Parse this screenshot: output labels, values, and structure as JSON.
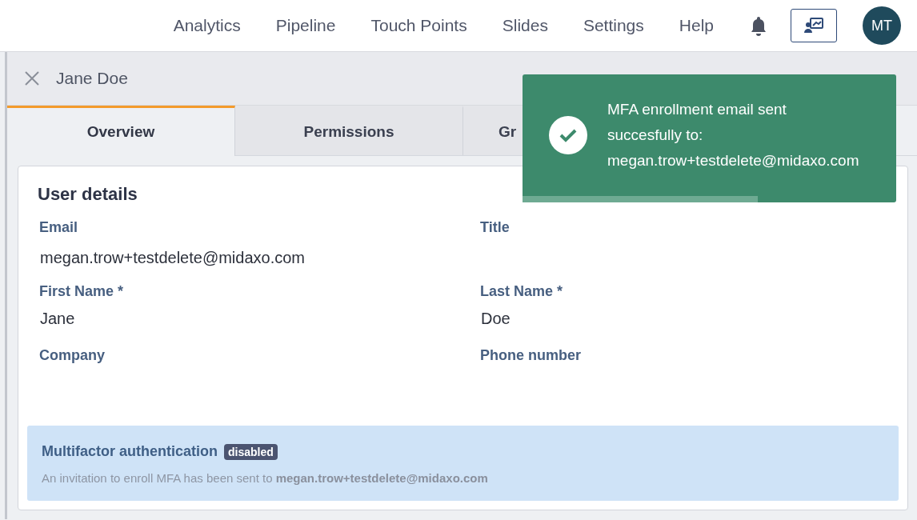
{
  "nav": {
    "links": [
      {
        "label": "Analytics"
      },
      {
        "label": "Pipeline"
      },
      {
        "label": "Touch Points"
      },
      {
        "label": "Slides"
      },
      {
        "label": "Settings"
      },
      {
        "label": "Help"
      }
    ],
    "avatar": "MT"
  },
  "panel": {
    "title": "Jane Doe",
    "tabs": [
      {
        "label": "Overview",
        "selected": true
      },
      {
        "label": "Permissions",
        "selected": false
      },
      {
        "label": "Gr",
        "selected": false
      }
    ],
    "section_title": "User details",
    "fields": [
      {
        "label": "Email",
        "value": "megan.trow+testdelete@midaxo.com"
      },
      {
        "label": "Title"
      },
      {
        "label": "First Name *",
        "value": "Jane"
      },
      {
        "label": "Last Name *",
        "value": "Doe"
      },
      {
        "label": "Company"
      },
      {
        "label": "Phone number"
      }
    ],
    "mfa": {
      "title": "Multifactor authentication",
      "badge": "disabled",
      "message": "An invitation to enroll MFA has been sent to **megan.trow+testdelete@midaxo.com**"
    }
  },
  "toast": {
    "lines": [
      "MFA enrollment email sent",
      "succesfully to:",
      "megan.trow+testdelete@midaxo.com"
    ],
    "level": 0.63
  }
}
